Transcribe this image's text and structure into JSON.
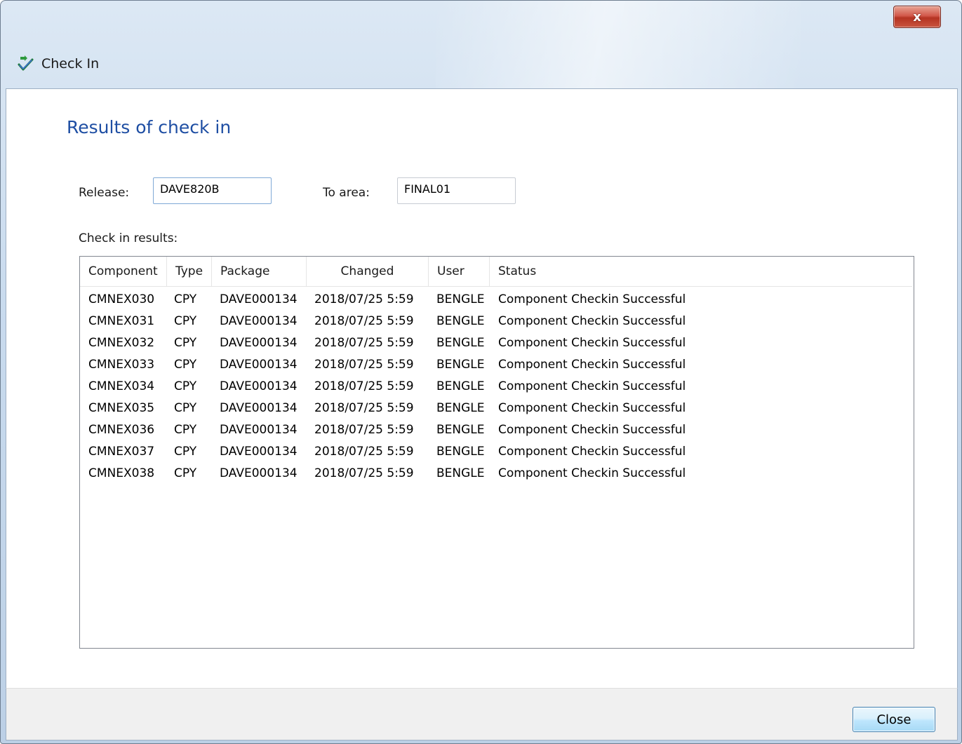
{
  "window": {
    "title": "Check In",
    "close_glyph": "x"
  },
  "main": {
    "heading": "Results of check in",
    "release_label": "Release:",
    "release_value": "DAVE820B",
    "to_area_label": "To area:",
    "to_area_value": "FINAL01",
    "results_label": "Check in results:"
  },
  "table": {
    "columns": [
      "Component",
      "Type",
      "Package",
      "Changed",
      "User",
      "Status"
    ],
    "rows": [
      [
        "CMNEX030",
        "CPY",
        "DAVE000134",
        "2018/07/25  5:59",
        "BENGLE",
        "Component Checkin Successful"
      ],
      [
        "CMNEX031",
        "CPY",
        "DAVE000134",
        "2018/07/25  5:59",
        "BENGLE",
        "Component Checkin Successful"
      ],
      [
        "CMNEX032",
        "CPY",
        "DAVE000134",
        "2018/07/25  5:59",
        "BENGLE",
        "Component Checkin Successful"
      ],
      [
        "CMNEX033",
        "CPY",
        "DAVE000134",
        "2018/07/25  5:59",
        "BENGLE",
        "Component Checkin Successful"
      ],
      [
        "CMNEX034",
        "CPY",
        "DAVE000134",
        "2018/07/25  5:59",
        "BENGLE",
        "Component Checkin Successful"
      ],
      [
        "CMNEX035",
        "CPY",
        "DAVE000134",
        "2018/07/25  5:59",
        "BENGLE",
        "Component Checkin Successful"
      ],
      [
        "CMNEX036",
        "CPY",
        "DAVE000134",
        "2018/07/25  5:59",
        "BENGLE",
        "Component Checkin Successful"
      ],
      [
        "CMNEX037",
        "CPY",
        "DAVE000134",
        "2018/07/25  5:59",
        "BENGLE",
        "Component Checkin Successful"
      ],
      [
        "CMNEX038",
        "CPY",
        "DAVE000134",
        "2018/07/25  5:59",
        "BENGLE",
        "Component Checkin Successful"
      ]
    ]
  },
  "footer": {
    "close_label": "Close"
  },
  "icons": {
    "app": "check-in-icon",
    "window_close": "close-icon"
  },
  "colors": {
    "heading": "#1e4ea3",
    "titlebar": "#c9dbee",
    "close_button": "#c9553f"
  }
}
